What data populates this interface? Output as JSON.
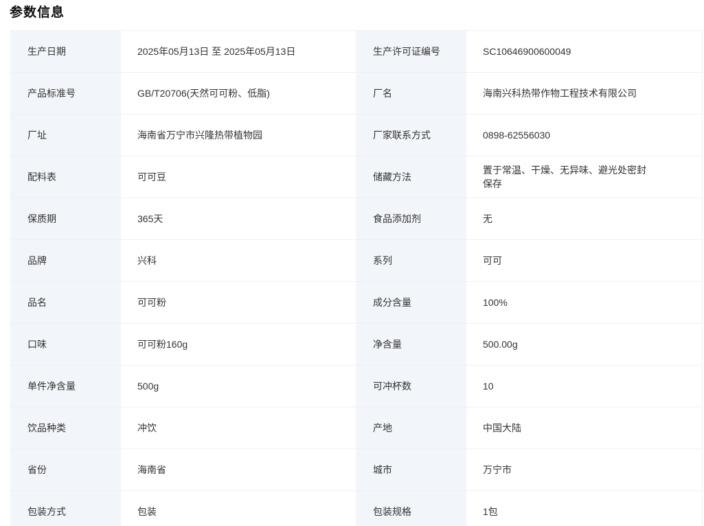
{
  "section": {
    "title": "参数信息"
  },
  "rows": [
    {
      "l1": "生产日期",
      "v1": "2025年05月13日 至 2025年05月13日",
      "l2": "生产许可证编号",
      "v2": "SC10646900600049"
    },
    {
      "l1": "产品标准号",
      "v1": "GB/T20706(天然可可粉、低脂)",
      "l2": "厂名",
      "v2": "海南兴科热带作物工程技术有限公司"
    },
    {
      "l1": "厂址",
      "v1": "海南省万宁市兴隆热带植物园",
      "l2": "厂家联系方式",
      "v2": "0898-62556030"
    },
    {
      "l1": "配料表",
      "v1": "可可豆",
      "l2": "储藏方法",
      "v2": "置于常温、干燥、无异味、避光处密封保存"
    },
    {
      "l1": "保质期",
      "v1": "365天",
      "l2": "食品添加剂",
      "v2": "无"
    },
    {
      "l1": "品牌",
      "v1": "兴科",
      "l2": "系列",
      "v2": "可可"
    },
    {
      "l1": "品名",
      "v1": "可可粉",
      "l2": "成分含量",
      "v2": "100%"
    },
    {
      "l1": "口味",
      "v1": "可可粉160g",
      "l2": "净含量",
      "v2": "500.00g"
    },
    {
      "l1": "单件净含量",
      "v1": "500g",
      "l2": "可冲杯数",
      "v2": "10"
    },
    {
      "l1": "饮品种类",
      "v1": "冲饮",
      "l2": "产地",
      "v2": "中国大陆"
    },
    {
      "l1": "省份",
      "v1": "海南省",
      "l2": "城市",
      "v2": "万宁市"
    },
    {
      "l1": "包装方式",
      "v1": "包装",
      "l2": "包装规格",
      "v2": "1包"
    }
  ]
}
